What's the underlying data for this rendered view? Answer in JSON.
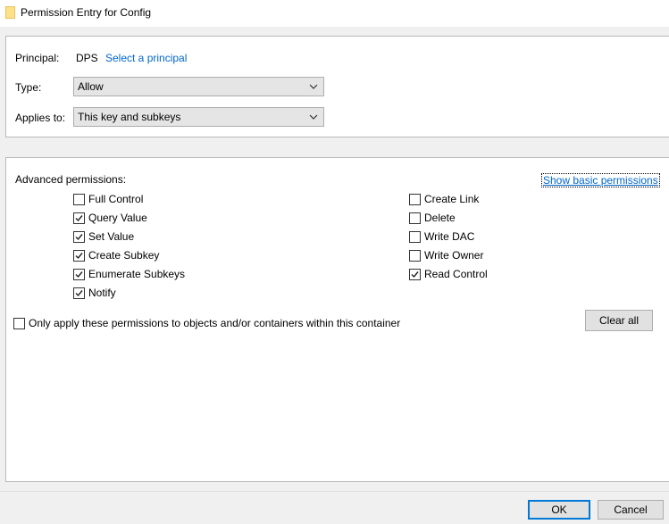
{
  "window": {
    "title": "Permission Entry for Config"
  },
  "principal": {
    "label": "Principal:",
    "value": "DPS",
    "select_link": "Select a principal"
  },
  "type": {
    "label": "Type:",
    "value": "Allow"
  },
  "applies_to": {
    "label": "Applies to:",
    "value": "This key and subkeys"
  },
  "advanced": {
    "heading": "Advanced permissions:",
    "show_basic_link": "Show basic permissions",
    "permissions_left": [
      {
        "label": "Full Control",
        "checked": false
      },
      {
        "label": "Query Value",
        "checked": true
      },
      {
        "label": "Set Value",
        "checked": true
      },
      {
        "label": "Create Subkey",
        "checked": true
      },
      {
        "label": "Enumerate Subkeys",
        "checked": true
      },
      {
        "label": "Notify",
        "checked": true
      }
    ],
    "permissions_right": [
      {
        "label": "Create Link",
        "checked": false
      },
      {
        "label": "Delete",
        "checked": false
      },
      {
        "label": "Write DAC",
        "checked": false
      },
      {
        "label": "Write Owner",
        "checked": false
      },
      {
        "label": "Read Control",
        "checked": true
      }
    ],
    "only_apply": {
      "label": "Only apply these permissions to objects and/or containers within this container",
      "checked": false
    },
    "clear_all_label": "Clear all"
  },
  "footer": {
    "ok_label": "OK",
    "cancel_label": "Cancel"
  }
}
